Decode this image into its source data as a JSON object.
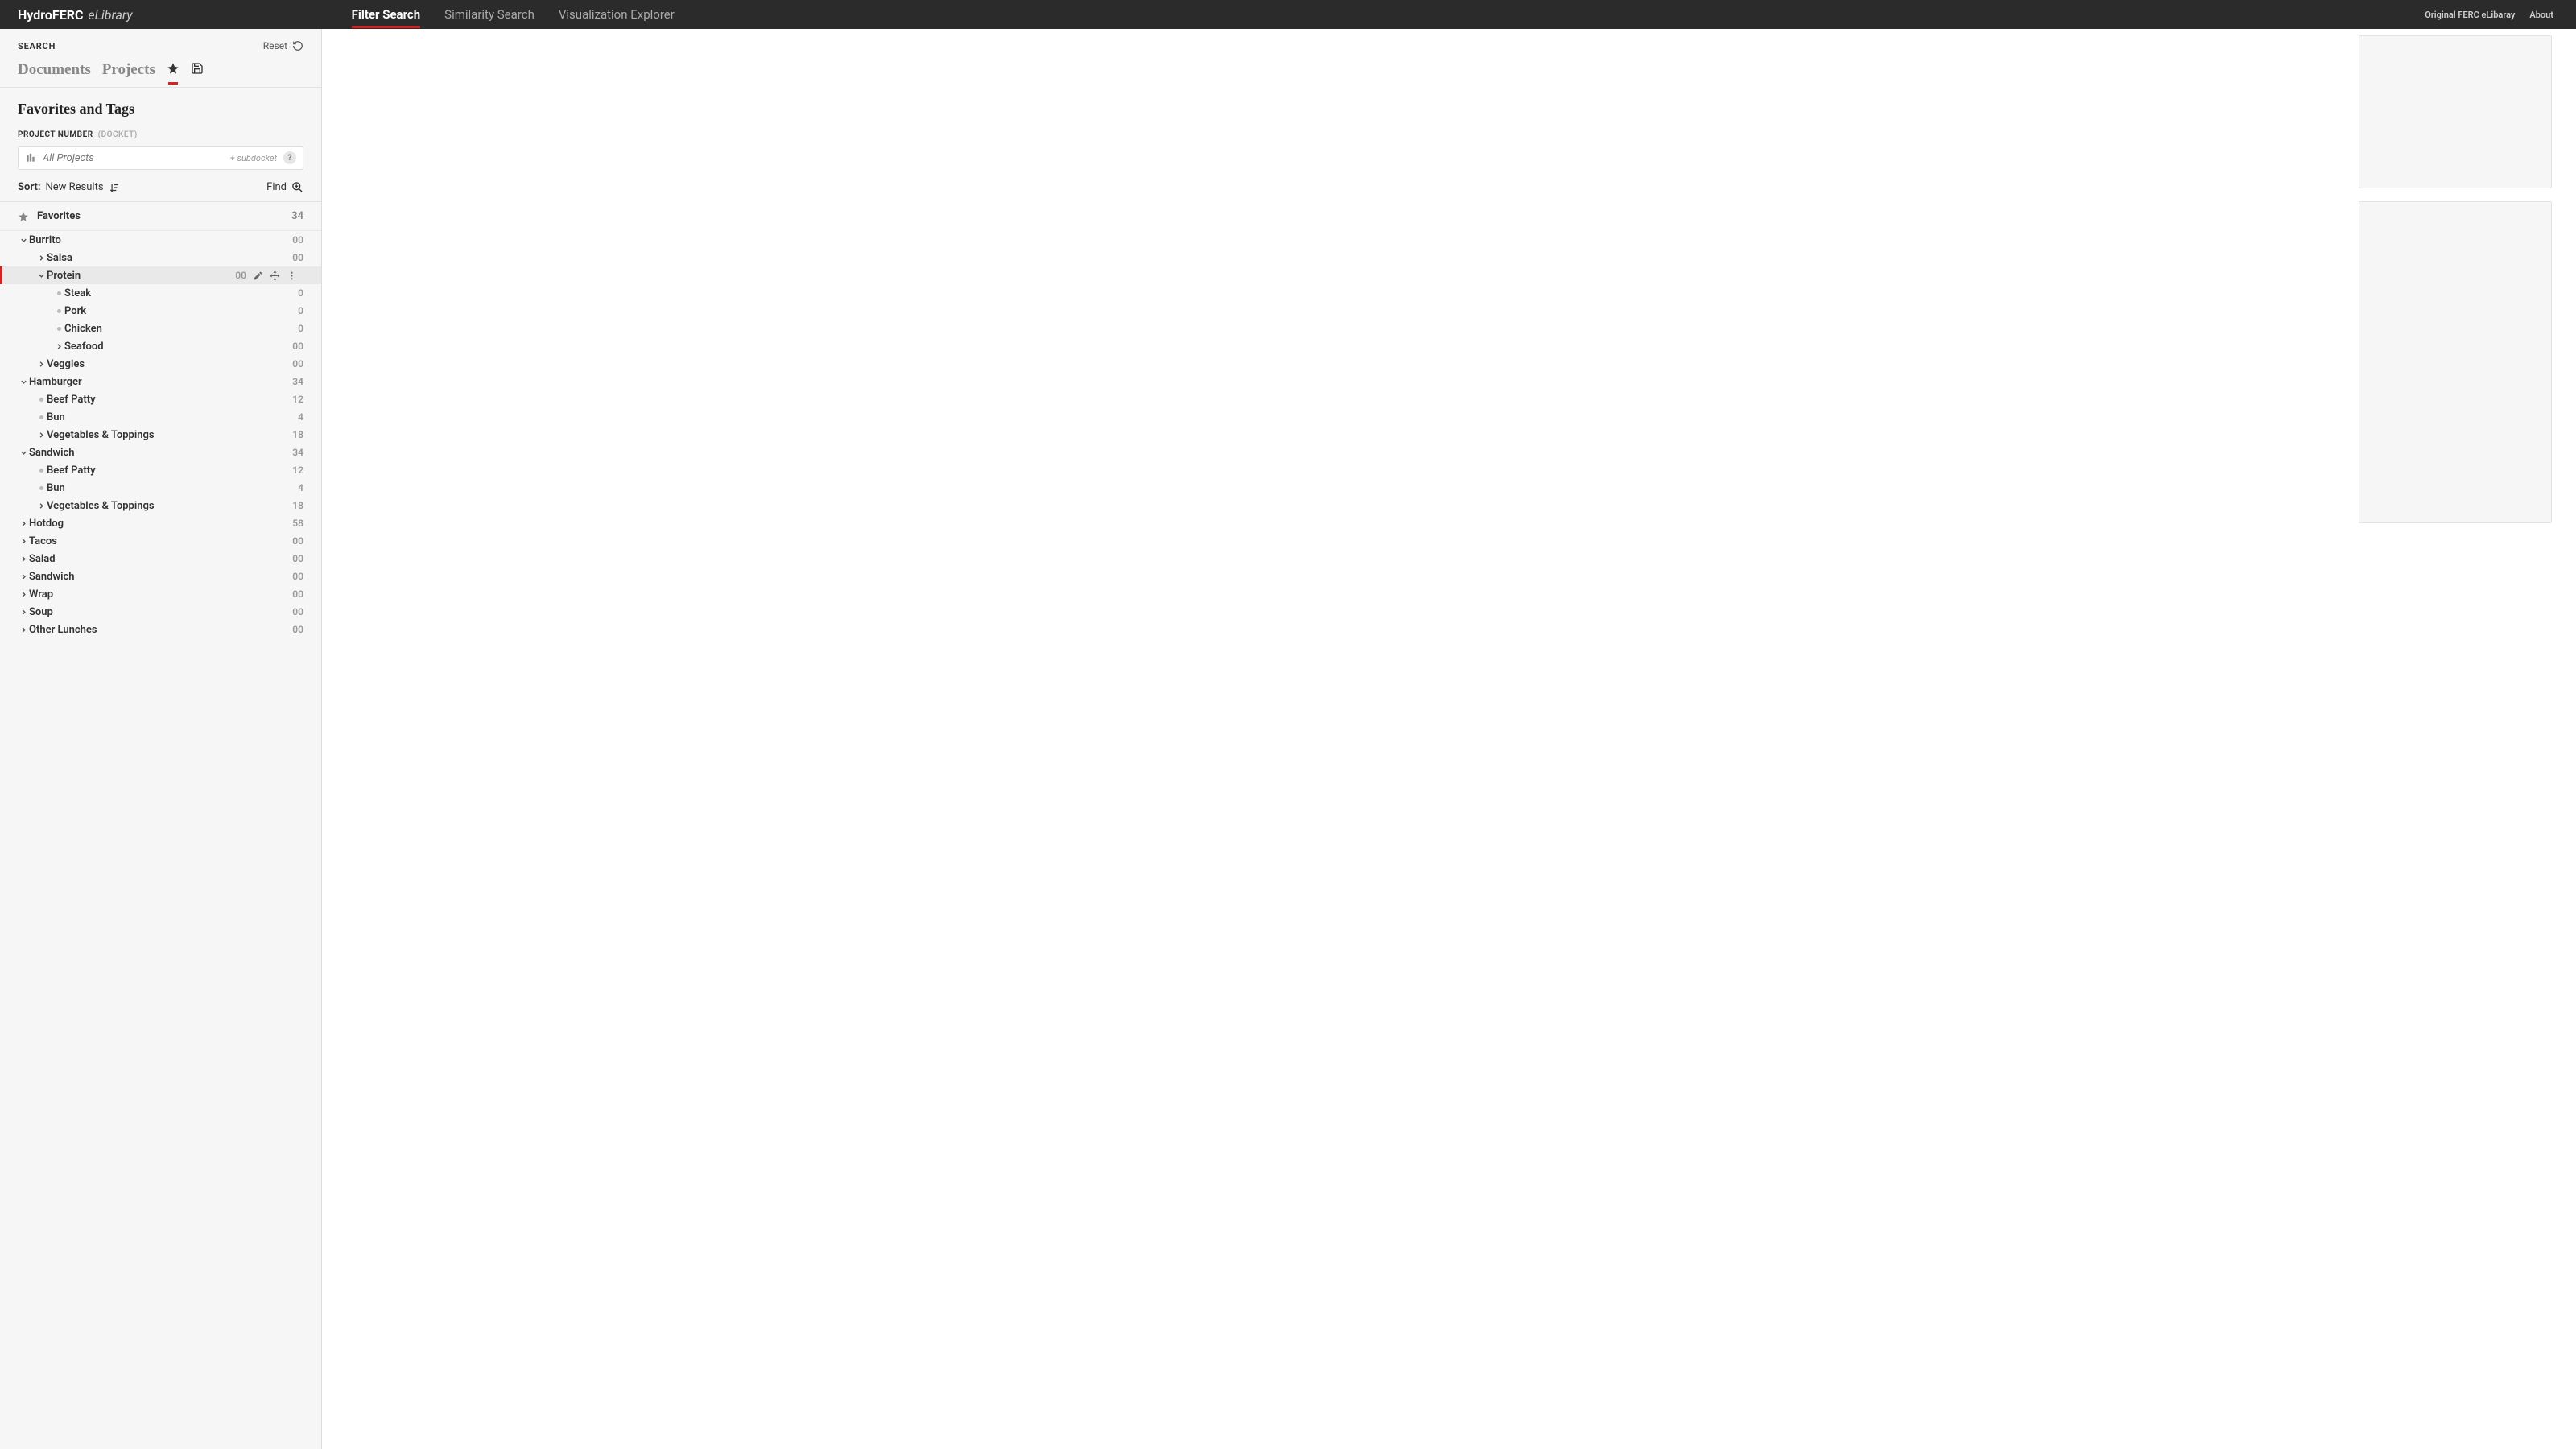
{
  "brand": {
    "part1": "HydroFERC",
    "part2": "eLibrary"
  },
  "topnav": {
    "filter": "Filter Search",
    "similarity": "Similarity Search",
    "viz": "Visualization Explorer"
  },
  "toplinks": {
    "orig": "Original FERC eLibaray",
    "about": "About"
  },
  "side": {
    "search": "SEARCH",
    "reset": "Reset",
    "tabs": {
      "documents": "Documents",
      "projects": "Projects"
    },
    "section": "Favorites and Tags",
    "projnum_lbl": "PROJECT NUMBER",
    "docket_lbl": "(DOCKET)",
    "input_placeholder": "All Projects",
    "subdocket": "+ subdocket",
    "qmark": "?",
    "sort_lbl": "Sort:",
    "sort_val": "New Results",
    "find": "Find",
    "fav_label": "Favorites",
    "fav_count": "34"
  },
  "tree": [
    {
      "lvl": 0,
      "icon": "down",
      "label": "Burrito",
      "cnt": "00"
    },
    {
      "lvl": 1,
      "icon": "right",
      "label": "Salsa",
      "cnt": "00"
    },
    {
      "lvl": 1,
      "icon": "down",
      "label": "Protein",
      "cnt": "00",
      "selected": true,
      "actions": true
    },
    {
      "lvl": 2,
      "icon": "dot",
      "label": "Steak",
      "cnt": "0"
    },
    {
      "lvl": 2,
      "icon": "dot",
      "label": "Pork",
      "cnt": "0"
    },
    {
      "lvl": 2,
      "icon": "dot",
      "label": "Chicken",
      "cnt": "0"
    },
    {
      "lvl": 2,
      "icon": "right",
      "label": "Seafood",
      "cnt": "00"
    },
    {
      "lvl": 1,
      "icon": "right",
      "label": "Veggies",
      "cnt": "00"
    },
    {
      "lvl": 0,
      "icon": "down",
      "label": "Hamburger",
      "cnt": "34"
    },
    {
      "lvl": 1,
      "icon": "dot",
      "label": "Beef Patty",
      "cnt": "12"
    },
    {
      "lvl": 1,
      "icon": "dot",
      "label": "Bun",
      "cnt": "4"
    },
    {
      "lvl": 1,
      "icon": "right",
      "label": "Vegetables & Toppings",
      "cnt": "18"
    },
    {
      "lvl": 0,
      "icon": "down",
      "label": "Sandwich",
      "cnt": "34"
    },
    {
      "lvl": 1,
      "icon": "dot",
      "label": "Beef Patty",
      "cnt": "12"
    },
    {
      "lvl": 1,
      "icon": "dot",
      "label": "Bun",
      "cnt": "4"
    },
    {
      "lvl": 1,
      "icon": "right",
      "label": "Vegetables & Toppings",
      "cnt": "18"
    },
    {
      "lvl": 0,
      "icon": "right",
      "label": "Hotdog",
      "cnt": "58"
    },
    {
      "lvl": 0,
      "icon": "right",
      "label": "Tacos",
      "cnt": "00"
    },
    {
      "lvl": 0,
      "icon": "right",
      "label": "Salad",
      "cnt": "00"
    },
    {
      "lvl": 0,
      "icon": "right",
      "label": "Sandwich",
      "cnt": "00"
    },
    {
      "lvl": 0,
      "icon": "right",
      "label": "Wrap",
      "cnt": "00"
    },
    {
      "lvl": 0,
      "icon": "right",
      "label": "Soup",
      "cnt": "00"
    },
    {
      "lvl": 0,
      "icon": "right",
      "label": "Other Lunches",
      "cnt": "00"
    }
  ]
}
